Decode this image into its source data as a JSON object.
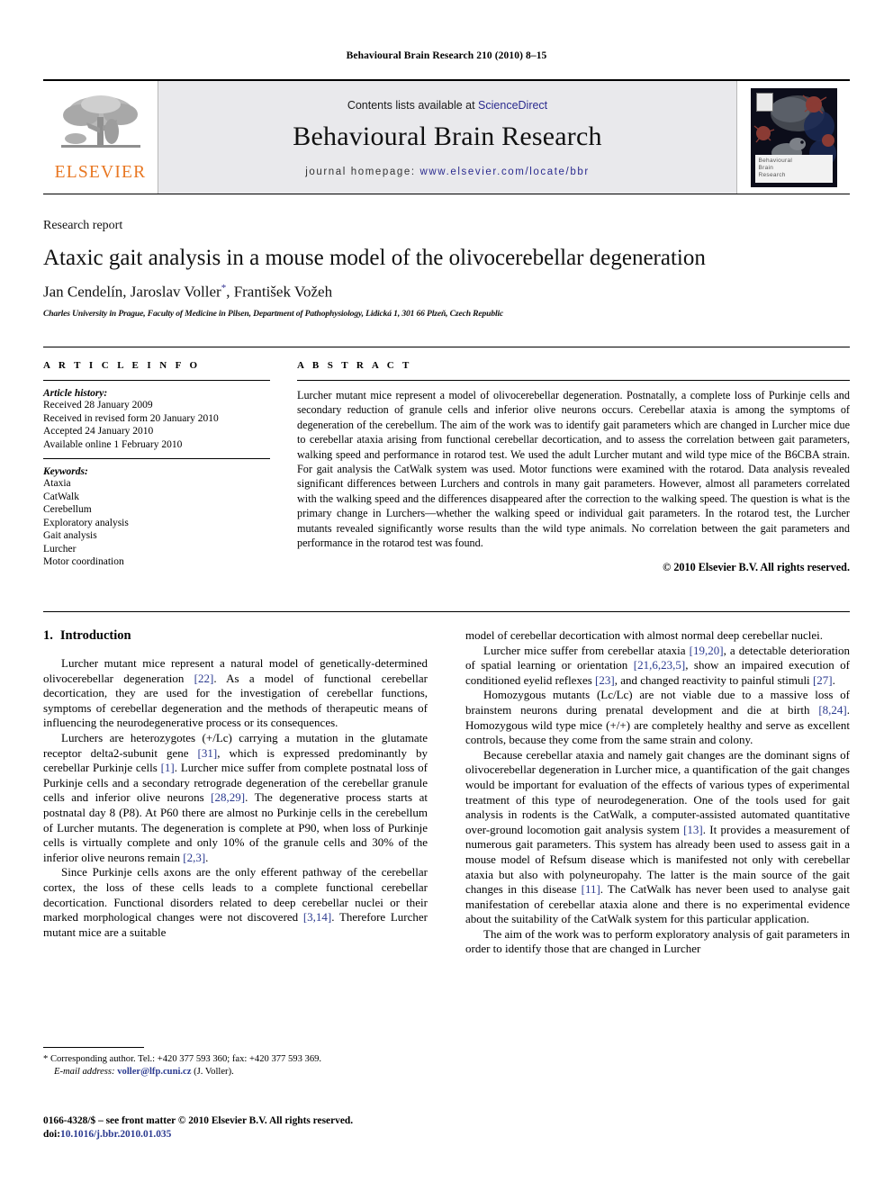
{
  "running_head": "Behavioural Brain Research 210 (2010) 8–15",
  "masthead": {
    "contents_prefix": "Contents lists available at ",
    "contents_link": "ScienceDirect",
    "journal_title": "Behavioural Brain Research",
    "homepage_prefix": "journal homepage: ",
    "homepage_url": "www.elsevier.com/locate/bbr",
    "publisher_wordmark": "ELSEVIER",
    "cover_title_line1": "Behavioural",
    "cover_title_line2": "Brain",
    "cover_title_line3": "Research",
    "link_color": "#2b2b8f",
    "wordmark_color": "#e87722"
  },
  "article": {
    "section_label": "Research report",
    "title": "Ataxic gait analysis in a mouse model of the olivocerebellar degeneration",
    "authors": "Jan Cendelín, Jaroslav Voller",
    "authors_tail": ", František Vožeh",
    "corresponding_marker": "*",
    "affiliation": "Charles University in Prague, Faculty of Medicine in Pilsen, Department of Pathophysiology, Lidická 1, 301 66 Plzeň, Czech Republic"
  },
  "article_info": {
    "heading": "A R T I C L E   I N F O",
    "history_heading": "Article history:",
    "history": [
      "Received 28 January 2009",
      "Received in revised form 20 January 2010",
      "Accepted 24 January 2010",
      "Available online 1 February 2010"
    ],
    "keywords_heading": "Keywords:",
    "keywords": [
      "Ataxia",
      "CatWalk",
      "Cerebellum",
      "Exploratory analysis",
      "Gait analysis",
      "Lurcher",
      "Motor coordination"
    ]
  },
  "abstract": {
    "heading": "A B S T R A C T",
    "text": "Lurcher mutant mice represent a model of olivocerebellar degeneration. Postnatally, a complete loss of Purkinje cells and secondary reduction of granule cells and inferior olive neurons occurs. Cerebellar ataxia is among the symptoms of degeneration of the cerebellum. The aim of the work was to identify gait parameters which are changed in Lurcher mice due to cerebellar ataxia arising from functional cerebellar decortication, and to assess the correlation between gait parameters, walking speed and performance in rotarod test. We used the adult Lurcher mutant and wild type mice of the B6CBA strain. For gait analysis the CatWalk system was used. Motor functions were examined with the rotarod. Data analysis revealed significant differences between Lurchers and controls in many gait parameters. However, almost all parameters correlated with the walking speed and the differences disappeared after the correction to the walking speed. The question is what is the primary change in Lurchers—whether the walking speed or individual gait parameters. In the rotarod test, the Lurcher mutants revealed significantly worse results than the wild type animals. No correlation between the gait parameters and performance in the rotarod test was found.",
    "copyright": "© 2010 Elsevier B.V. All rights reserved."
  },
  "introduction": {
    "number": "1.",
    "heading": "Introduction",
    "left_paragraphs": [
      {
        "segments": [
          {
            "t": "Lurcher mutant mice represent a natural model of genetically-determined olivocerebellar degeneration "
          },
          {
            "t": "[22]",
            "ref": true
          },
          {
            "t": ". As a model of functional cerebellar decortication, they are used for the investigation of cerebellar functions, symptoms of cerebellar degeneration and the methods of therapeutic means of influencing the neurodegenerative process or its consequences."
          }
        ]
      },
      {
        "segments": [
          {
            "t": "Lurchers are heterozygotes (+/Lc) carrying a mutation in the glutamate receptor delta2-subunit gene "
          },
          {
            "t": "[31]",
            "ref": true
          },
          {
            "t": ", which is expressed predominantly by cerebellar Purkinje cells "
          },
          {
            "t": "[1]",
            "ref": true
          },
          {
            "t": ". Lurcher mice suffer from complete postnatal loss of Purkinje cells and a secondary retrograde degeneration of the cerebellar granule cells and inferior olive neurons "
          },
          {
            "t": "[28,29]",
            "ref": true
          },
          {
            "t": ". The degenerative process starts at postnatal day 8 (P8). At P60 there are almost no Purkinje cells in the cerebellum of Lurcher mutants. The degeneration is complete at P90, when loss of Purkinje cells is virtually complete and only 10% of the granule cells and 30% of the inferior olive neurons remain "
          },
          {
            "t": "[2,3]",
            "ref": true
          },
          {
            "t": "."
          }
        ]
      },
      {
        "segments": [
          {
            "t": "Since Purkinje cells axons are the only efferent pathway of the cerebellar cortex, the loss of these cells leads to a complete functional cerebellar decortication. Functional disorders related to deep cerebellar nuclei or their marked morphological changes were not discovered "
          },
          {
            "t": "[3,14]",
            "ref": true
          },
          {
            "t": ". Therefore Lurcher mutant mice are a suitable"
          }
        ]
      }
    ],
    "right_paragraphs": [
      {
        "no_indent": true,
        "segments": [
          {
            "t": "model of cerebellar decortication with almost normal deep cerebellar nuclei."
          }
        ]
      },
      {
        "segments": [
          {
            "t": "Lurcher mice suffer from cerebellar ataxia "
          },
          {
            "t": "[19,20]",
            "ref": true
          },
          {
            "t": ", a detectable deterioration of spatial learning or orientation "
          },
          {
            "t": "[21,6,23,5]",
            "ref": true
          },
          {
            "t": ", show an impaired execution of conditioned eyelid reflexes "
          },
          {
            "t": "[23]",
            "ref": true
          },
          {
            "t": ", and changed reactivity to painful stimuli "
          },
          {
            "t": "[27]",
            "ref": true
          },
          {
            "t": "."
          }
        ]
      },
      {
        "segments": [
          {
            "t": "Homozygous mutants (Lc/Lc) are not viable due to a massive loss of brainstem neurons during prenatal development and die at birth "
          },
          {
            "t": "[8,24]",
            "ref": true
          },
          {
            "t": ". Homozygous wild type mice (+/+) are completely healthy and serve as excellent controls, because they come from the same strain and colony."
          }
        ]
      },
      {
        "segments": [
          {
            "t": "Because cerebellar ataxia and namely gait changes are the dominant signs of olivocerebellar degeneration in Lurcher mice, a quantification of the gait changes would be important for evaluation of the effects of various types of experimental treatment of this type of neurodegeneration. One of the tools used for gait analysis in rodents is the CatWalk, a computer-assisted automated quantitative over-ground locomotion gait analysis system "
          },
          {
            "t": "[13]",
            "ref": true
          },
          {
            "t": ". It provides a measurement of numerous gait parameters. This system has already been used to assess gait in a mouse model of Refsum disease which is manifested not only with cerebellar ataxia but also with polyneuropahy. The latter is the main source of the gait changes in this disease "
          },
          {
            "t": "[11]",
            "ref": true
          },
          {
            "t": ". The CatWalk has never been used to analyse gait manifestation of cerebellar ataxia alone and there is no experimental evidence about the suitability of the CatWalk system for this particular application."
          }
        ]
      },
      {
        "segments": [
          {
            "t": "The aim of the work was to perform exploratory analysis of gait parameters in order to identify those that are changed in Lurcher"
          }
        ]
      }
    ]
  },
  "footnotes": {
    "corresponding": "* Corresponding author. Tel.: +420 377 593 360; fax: +420 377 593 369.",
    "email_label": "E-mail address:",
    "email": "voller@lfp.cuni.cz",
    "email_owner": "(J. Voller).",
    "issn_line": "0166-4328/$ – see front matter © 2010 Elsevier B.V. All rights reserved.",
    "doi_label": "doi:",
    "doi": "10.1016/j.bbr.2010.01.035"
  }
}
